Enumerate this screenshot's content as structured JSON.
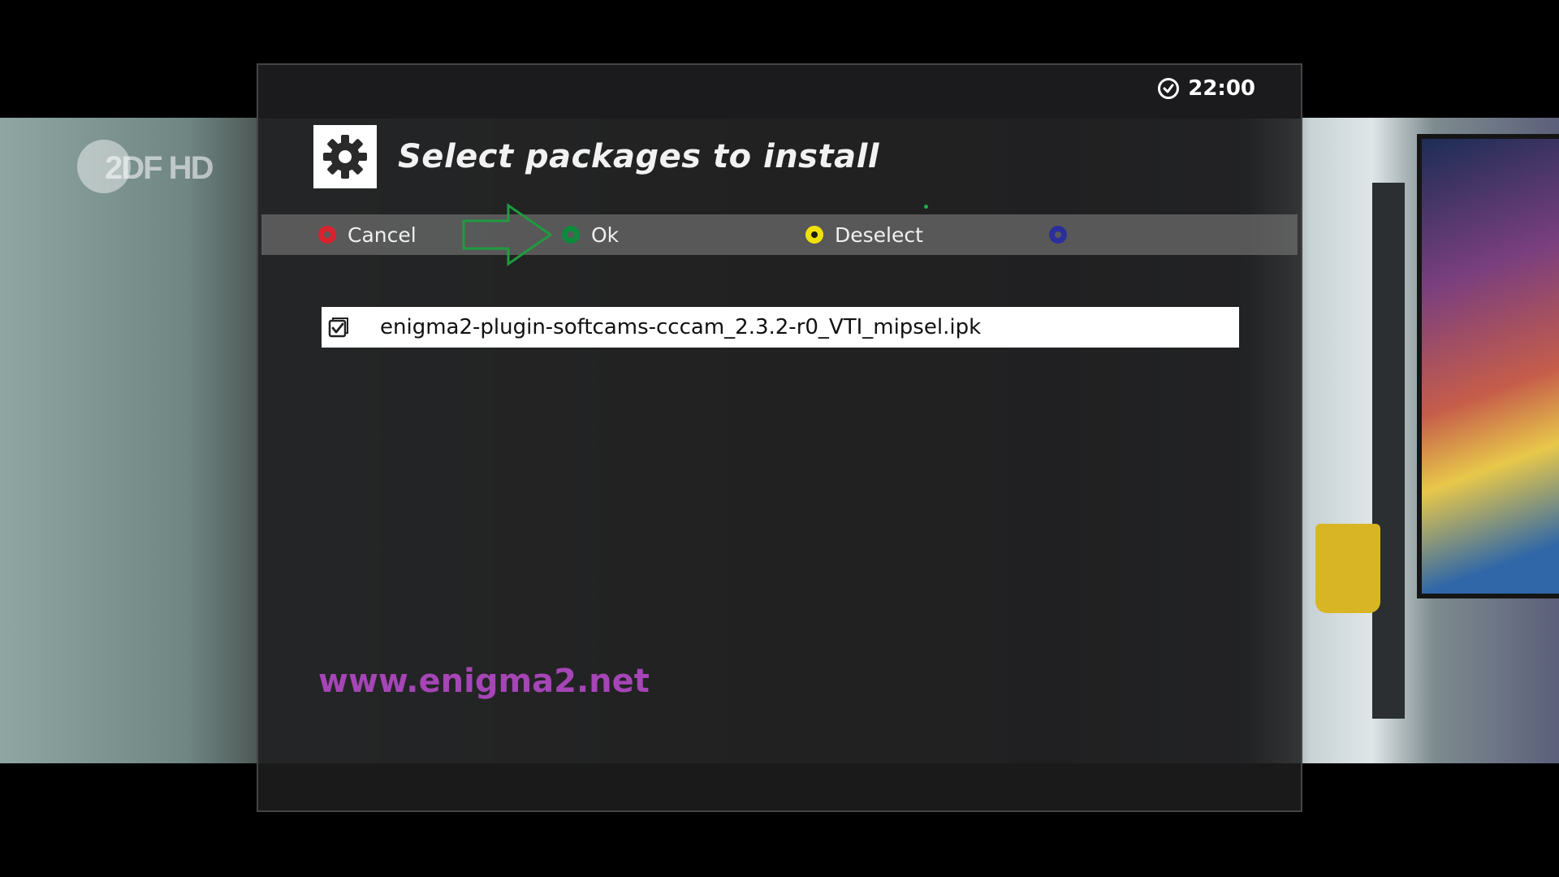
{
  "channel": {
    "logo_text": "2DF HD"
  },
  "clock": {
    "time": "22:00",
    "icon": "clock-icon"
  },
  "header": {
    "title": "Select packages to install",
    "icon": "gear-icon"
  },
  "buttons": {
    "red": {
      "label": "Cancel",
      "color": "#d8232f"
    },
    "green": {
      "label": "Ok",
      "color": "#0e8a3c"
    },
    "yellow": {
      "label": "Deselect",
      "color": "#f1e10a"
    },
    "blue": {
      "label": "",
      "color": "#2a2f9c"
    }
  },
  "annotation": {
    "arrow_color": "#1e9c3f",
    "points_to": "green-button"
  },
  "packages": [
    {
      "name": "enigma2-plugin-softcams-cccam_2.3.2-r0_VTI_mipsel.ipk",
      "checked": true
    }
  ],
  "watermark": {
    "text": "www.enigma2.net",
    "color": "#a545b6"
  }
}
